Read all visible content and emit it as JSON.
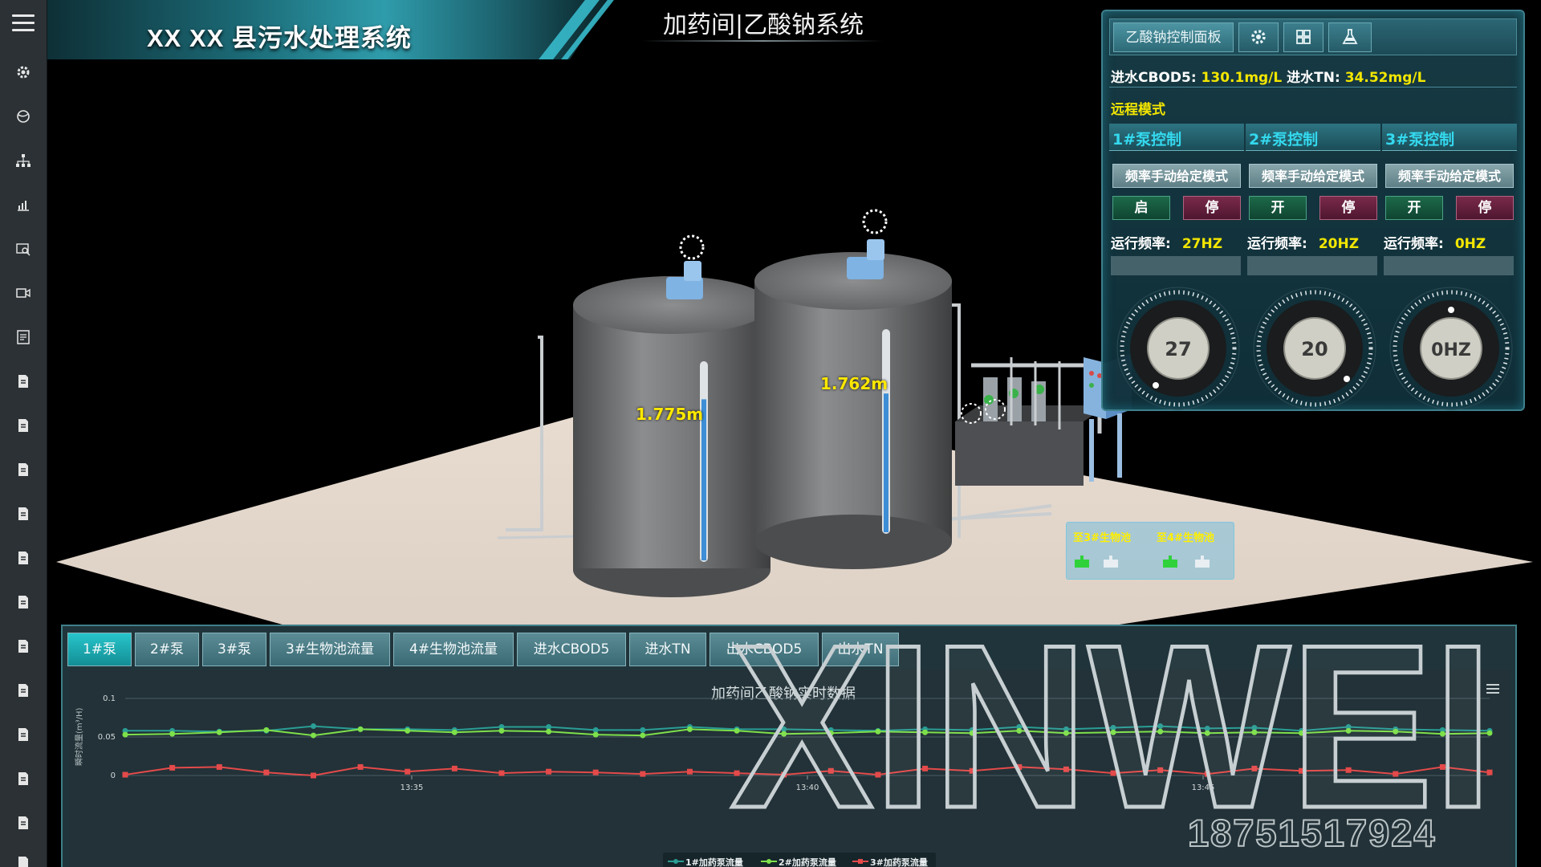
{
  "header": {
    "app_title": "XX XX 县污水处理系统",
    "page_title": "加药间|乙酸钠系统"
  },
  "sidebar": {
    "icons": [
      "menu-icon",
      "gear-icon",
      "globe-icon",
      "org-chart-icon",
      "chart-icon",
      "search-image-icon",
      "video-icon",
      "report-icon",
      "document-icon",
      "document-icon",
      "document-icon",
      "document-icon",
      "document-icon",
      "document-icon",
      "document-icon",
      "document-icon",
      "document-icon",
      "document-icon",
      "document-icon",
      "document-icon"
    ]
  },
  "scene": {
    "tank1_level": "1.775m",
    "tank2_level": "1.762m",
    "tank1_fill": 0.85,
    "tank2_fill": 0.72,
    "dest_label_1": "至3#生物池",
    "dest_label_2": "至4#生物池"
  },
  "control_panel": {
    "tab_label": "乙酸钠控制面板",
    "tab_icons": [
      "gear-icon",
      "grid-icon",
      "flask-icon"
    ],
    "inlet_cbod5_label": "进水CBOD5:",
    "inlet_cbod5_value": "130.1mg/L",
    "inlet_tn_label": "进水TN:",
    "inlet_tn_value": "34.52mg/L",
    "mode": "远程模式",
    "pumps": [
      {
        "title": "1#泵控制",
        "mode_btn": "频率手动给定模式",
        "start_btn": "启",
        "stop_btn": "停",
        "freq_label": "运行频率:",
        "freq_value": "27HZ",
        "knob_text": "27"
      },
      {
        "title": "2#泵控制",
        "mode_btn": "频率手动给定模式",
        "start_btn": "开",
        "stop_btn": "停",
        "freq_label": "运行频率:",
        "freq_value": "20HZ",
        "knob_text": "20"
      },
      {
        "title": "3#泵控制",
        "mode_btn": "频率手动给定模式",
        "start_btn": "开",
        "stop_btn": "停",
        "freq_label": "运行频率:",
        "freq_value": "0HZ",
        "knob_text": "0HZ"
      }
    ]
  },
  "trend": {
    "tabs": [
      "1#泵",
      "2#泵",
      "3#泵",
      "3#生物池流量",
      "4#生物池流量",
      "进水CBOD5",
      "进水TN",
      "出水CBOD5",
      "出水TN"
    ],
    "active_tab": 0,
    "chart_title": "加药间乙酸钠实时数据",
    "menu_icon": "menu-icon"
  },
  "chart_data": {
    "type": "line",
    "title": "加药间乙酸钠实时数据",
    "ylabel": "瞬时流量(m³/H)",
    "ylim": [
      0,
      0.1
    ],
    "yticks": [
      "0.1",
      "0.05",
      "0"
    ],
    "xticks": [
      "13:35",
      "13:40",
      "13:45"
    ],
    "grid": true,
    "legend_position": "bottom",
    "series": [
      {
        "name": "1#加药泵流量",
        "color": "#2a9d95",
        "values": [
          0.058,
          0.058,
          0.057,
          0.058,
          0.064,
          0.06,
          0.06,
          0.059,
          0.063,
          0.063,
          0.059,
          0.059,
          0.063,
          0.06,
          0.06,
          0.059,
          0.058,
          0.06,
          0.059,
          0.063,
          0.06,
          0.062,
          0.064,
          0.061,
          0.062,
          0.058,
          0.063,
          0.06,
          0.059,
          0.058
        ]
      },
      {
        "name": "2#加药泵流量",
        "color": "#7ee04a",
        "values": [
          0.053,
          0.054,
          0.056,
          0.059,
          0.052,
          0.06,
          0.058,
          0.056,
          0.058,
          0.057,
          0.053,
          0.052,
          0.06,
          0.058,
          0.054,
          0.055,
          0.057,
          0.056,
          0.055,
          0.058,
          0.055,
          0.056,
          0.057,
          0.055,
          0.056,
          0.055,
          0.058,
          0.057,
          0.054,
          0.055
        ]
      },
      {
        "name": "3#加药泵流量",
        "color": "#e44a4a",
        "values": [
          0.001,
          0.01,
          0.011,
          0.004,
          0.0,
          0.011,
          0.005,
          0.009,
          0.003,
          0.005,
          0.004,
          0.002,
          0.005,
          0.003,
          0.001,
          0.006,
          0.001,
          0.009,
          0.006,
          0.011,
          0.008,
          0.003,
          0.007,
          0.002,
          0.009,
          0.006,
          0.007,
          0.002,
          0.011,
          0.004
        ]
      }
    ]
  },
  "watermark": {
    "brand": "XINWEI",
    "phone": "18751517924"
  },
  "colors": {
    "accent": "#27c5cb",
    "value_yellow": "#f3e600",
    "pump_title": "#34d9ee"
  }
}
